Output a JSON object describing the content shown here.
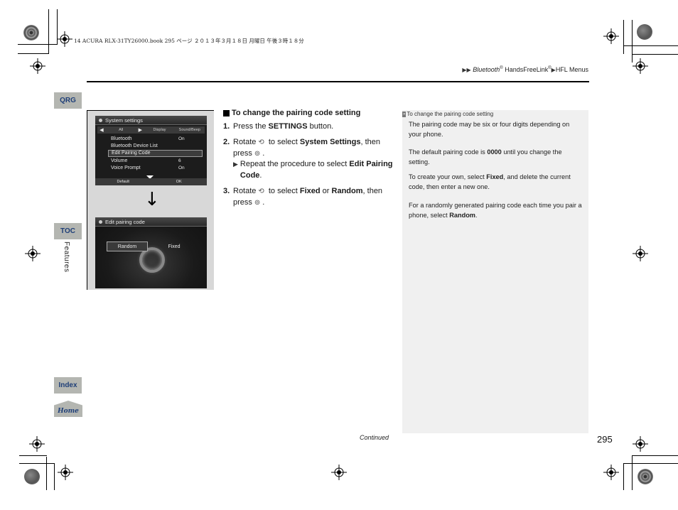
{
  "file_header": "14 ACURA RLX-31TY26000.book  295 ページ  ２０１３年３月１８日  月曜日  午後３時１８分",
  "breadcrumb": {
    "items": [
      "Bluetooth",
      "HandsFreeLink",
      "HFL Menus"
    ],
    "reg_mark": "®"
  },
  "side_tabs": {
    "qrg": "QRG",
    "toc": "TOC",
    "section": "Features",
    "index": "Index",
    "home": "Home"
  },
  "screen1": {
    "title": "System settings",
    "tabs": [
      "All",
      "Display",
      "Sound/Beep"
    ],
    "rows": [
      {
        "label": "Bluetooth",
        "value": "On"
      },
      {
        "label": "Bluetooth Device List",
        "value": ""
      },
      {
        "label": "Edit Pairing Code",
        "value": "",
        "selected": true
      },
      {
        "label": "Volume",
        "value": "6"
      },
      {
        "label": "Voice Prompt",
        "value": "On"
      }
    ],
    "footer": [
      "Default",
      "OK"
    ]
  },
  "screen2": {
    "title": "Edit pairing code",
    "options": [
      "Random",
      "Fixed"
    ]
  },
  "main": {
    "heading": "To change the pairing code setting",
    "steps": [
      {
        "num": "1.",
        "pre": "Press the ",
        "bold": "SETTINGS",
        "post": " button."
      },
      {
        "num": "2.",
        "pre": "Rotate",
        "mid": " to select ",
        "bold": "System Settings",
        "post": ", then press",
        "end": "."
      },
      {
        "num": "3.",
        "pre": "Rotate",
        "mid": " to select ",
        "bold1": "Fixed",
        "or": " or ",
        "bold2": "Random",
        "post": ", then press",
        "end": "."
      }
    ],
    "sub_note": {
      "pre": "Repeat the procedure to select ",
      "bold": "Edit Pairing Code",
      "post": "."
    }
  },
  "note": {
    "heading": "To change the pairing code setting",
    "p1": "The pairing code may be six or four digits depending on your phone.",
    "p2_pre": "The default pairing code is ",
    "p2_bold": "0000",
    "p2_post": " until you change the setting.",
    "p3_pre": "To create your own, select ",
    "p3_bold": "Fixed",
    "p3_post": ", and delete the current code, then enter a new one.",
    "p4_pre": "For a randomly generated pairing code each time you pair a phone, select ",
    "p4_bold": "Random",
    "p4_post": "."
  },
  "footer": {
    "continued": "Continued",
    "page_number": "295"
  }
}
